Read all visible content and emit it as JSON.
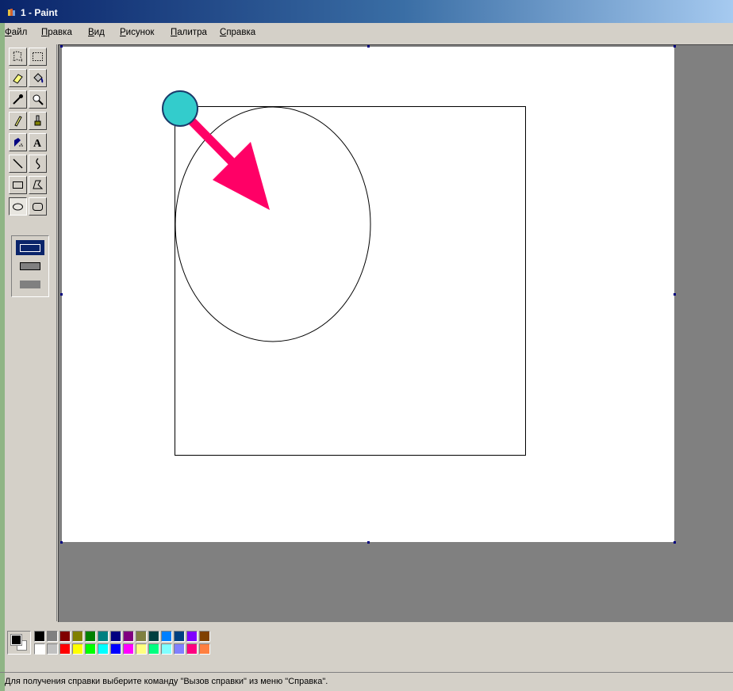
{
  "window": {
    "title": "1 - Paint",
    "icon": "paint-app-icon"
  },
  "menu": [
    {
      "id": "file",
      "label": "Файл"
    },
    {
      "id": "edit",
      "label": "Правка"
    },
    {
      "id": "view",
      "label": "Вид"
    },
    {
      "id": "image",
      "label": "Рисунок"
    },
    {
      "id": "palette",
      "label": "Палитра"
    },
    {
      "id": "help",
      "label": "Справка"
    }
  ],
  "tools": [
    {
      "id": "free-select",
      "icon": "free-select-icon"
    },
    {
      "id": "rect-select",
      "icon": "rect-select-icon"
    },
    {
      "id": "eraser",
      "icon": "eraser-icon"
    },
    {
      "id": "fill",
      "icon": "fill-bucket-icon"
    },
    {
      "id": "pick-color",
      "icon": "eyedropper-icon"
    },
    {
      "id": "magnifier",
      "icon": "magnifier-icon"
    },
    {
      "id": "pencil",
      "icon": "pencil-icon"
    },
    {
      "id": "brush",
      "icon": "brush-icon"
    },
    {
      "id": "airbrush",
      "icon": "airbrush-icon"
    },
    {
      "id": "text",
      "icon": "text-icon",
      "glyph": "A"
    },
    {
      "id": "line",
      "icon": "line-icon"
    },
    {
      "id": "curve",
      "icon": "curve-icon"
    },
    {
      "id": "rectangle",
      "icon": "rectangle-icon"
    },
    {
      "id": "polygon",
      "icon": "polygon-icon"
    },
    {
      "id": "ellipse",
      "icon": "ellipse-icon",
      "selected": true
    },
    {
      "id": "rounded-rectangle",
      "icon": "rounded-rectangle-icon"
    }
  ],
  "fill_style_options": [
    "outline",
    "outline-with-fill",
    "fill-only"
  ],
  "selected_fill_style": "outline",
  "colors": {
    "foreground": "#000000",
    "background": "#ffffff",
    "annotation_arrow": "#ff0066",
    "annotation_dot": "#33cccc",
    "palette_row1": [
      "#000000",
      "#808080",
      "#800000",
      "#808000",
      "#008000",
      "#008080",
      "#000080",
      "#800080",
      "#808040",
      "#004040",
      "#0080ff",
      "#004080",
      "#8000ff",
      "#804000"
    ],
    "palette_row2": [
      "#ffffff",
      "#c0c0c0",
      "#ff0000",
      "#ffff00",
      "#00ff00",
      "#00ffff",
      "#0000ff",
      "#ff00ff",
      "#ffff80",
      "#00ff80",
      "#80ffff",
      "#8080ff",
      "#ff0080",
      "#ff8040"
    ]
  },
  "drawing": {
    "shapes": [
      "rectangle",
      "ellipse"
    ],
    "annotation": "arrow-from-start-point"
  },
  "statusbar": {
    "text": "Для получения справки выберите команду \"Вызов справки\" из меню \"Справка\"."
  }
}
